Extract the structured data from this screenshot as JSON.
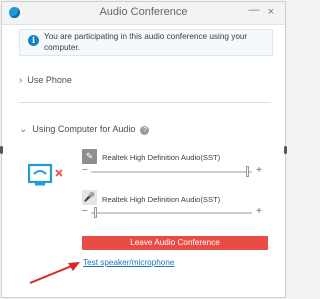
{
  "window": {
    "title": "Audio Conference",
    "minimize_glyph": "—",
    "close_glyph": "×"
  },
  "info_banner": {
    "icon": "info-icon",
    "text": "You are participating in this audio conference using your computer."
  },
  "sections": {
    "use_phone": {
      "label": "Use Phone",
      "state": "collapsed"
    },
    "use_computer": {
      "label": "Using Computer for Audio",
      "state": "expanded"
    }
  },
  "devices": {
    "speaker": {
      "label": "Realtek High Definition Audio(SST)",
      "icon": "speaker-muted-icon",
      "level": 0.97
    },
    "microphone": {
      "label": "Realtek High Definition Audio(SST)",
      "icon": "microphone-icon",
      "level": 0.03
    }
  },
  "actions": {
    "leave": "Leave Audio Conference",
    "test_link": "Test speaker/microphone"
  },
  "colors": {
    "accent": "#1f9bd7",
    "danger": "#e94b47",
    "link": "#1a73c9",
    "annotation_arrow": "#d62626"
  }
}
